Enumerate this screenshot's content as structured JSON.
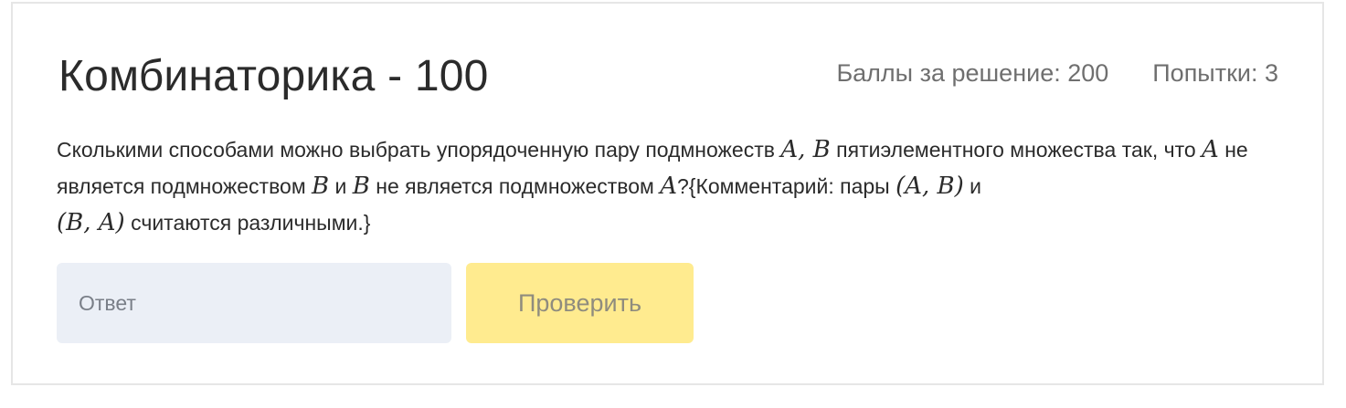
{
  "problem": {
    "title": "Комбинаторика - 100",
    "points_label": "Баллы за решение: 200",
    "attempts_label": "Попытки: 3",
    "question": {
      "p1": "Сколькими способами можно выбрать упорядоченную пару подмножеств ",
      "m1": "A, B",
      "p2": " пятиэлементного множества так, что ",
      "m2": "A",
      "p3": " не является подмножеством ",
      "m3": "B",
      "p4": " и ",
      "m4": "B",
      "p5": " не является подмножеством ",
      "m5": "A",
      "p6": "?{Комментарий: пары ",
      "m6": "(A, B)",
      "p7": " и ",
      "m7": "(B, A)",
      "p8": " считаются различными.}"
    }
  },
  "answer": {
    "placeholder": "Ответ",
    "value": ""
  },
  "check_button": {
    "label": "Проверить"
  },
  "colors": {
    "input_bg": "#ebeff6",
    "button_bg": "#ffeb8f",
    "border": "#e6e6e6"
  }
}
